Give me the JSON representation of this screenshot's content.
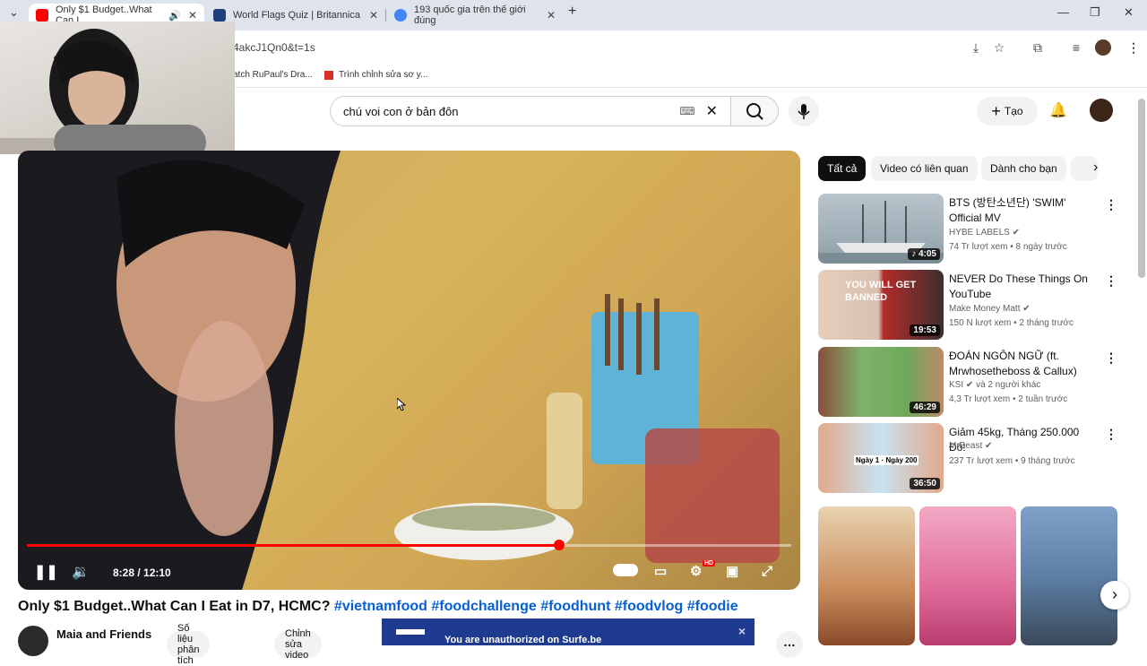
{
  "browser": {
    "tabs": [
      {
        "title": "Only $1 Budget..What Can I",
        "active": true
      },
      {
        "title": "World Flags Quiz | Britannica"
      },
      {
        "title": "193 quốc gia trên thế giới đúng"
      }
    ],
    "new_tab": "+",
    "url": "s4akcJ1Qn0&t=1s",
    "bookmarks": [
      "atch RuPaul's Dra...",
      "Trình chỉnh sửa sơ y..."
    ]
  },
  "youtube": {
    "search_value": "chú voi con ở bản đôn",
    "create_label": "Tạo"
  },
  "player": {
    "time": "8:28 / 12:10",
    "progress": 0.696,
    "hd_badge": "HD"
  },
  "video": {
    "title_main": "Only $1 Budget..What Can I Eat in D7, HCMC?",
    "hashtags": [
      "#vietnamfood",
      "#foodchallenge",
      "#foodhunt",
      "#foodvlog",
      "#foodie"
    ],
    "channel": "Maia and Friends",
    "actions": [
      "Số liệu phân tích",
      "Chỉnh sửa video"
    ]
  },
  "chips": [
    "Tất cả",
    "Video có liên quan",
    "Dành cho bạn"
  ],
  "recommendations": [
    {
      "title": "BTS (방탄소년단) 'SWIM' Official MV",
      "channel": "HYBE LABELS",
      "meta": "74 Tr lượt xem • 8 ngày trước",
      "duration": "♪ 4:05",
      "thumb_text": ""
    },
    {
      "title": "NEVER Do These Things On YouTube",
      "channel": "Make Money Matt",
      "meta": "150 N lượt xem • 2 tháng trước",
      "duration": "19:53",
      "thumb_text": "YOU WILL GET BANNED"
    },
    {
      "title": "ĐOÁN NGÔN NGỮ (ft. Mrwhosetheboss & Callux)",
      "channel": "KSI",
      "channel_extra": "và 2 người khác",
      "meta": "4,3 Tr lượt xem • 2 tuần trước",
      "duration": "46:29",
      "thumb_text": ""
    },
    {
      "title": "Giảm 45kg, Tháng 250.000 Đô!",
      "channel": "MrBeast",
      "meta": "237 Tr lượt xem • 9 tháng trước",
      "duration": "36:50",
      "thumb_text": "Ngày 1 · Ngày 200"
    }
  ],
  "toast": {
    "message": "You are unauthorized on Surfe.be",
    "close": "×"
  }
}
